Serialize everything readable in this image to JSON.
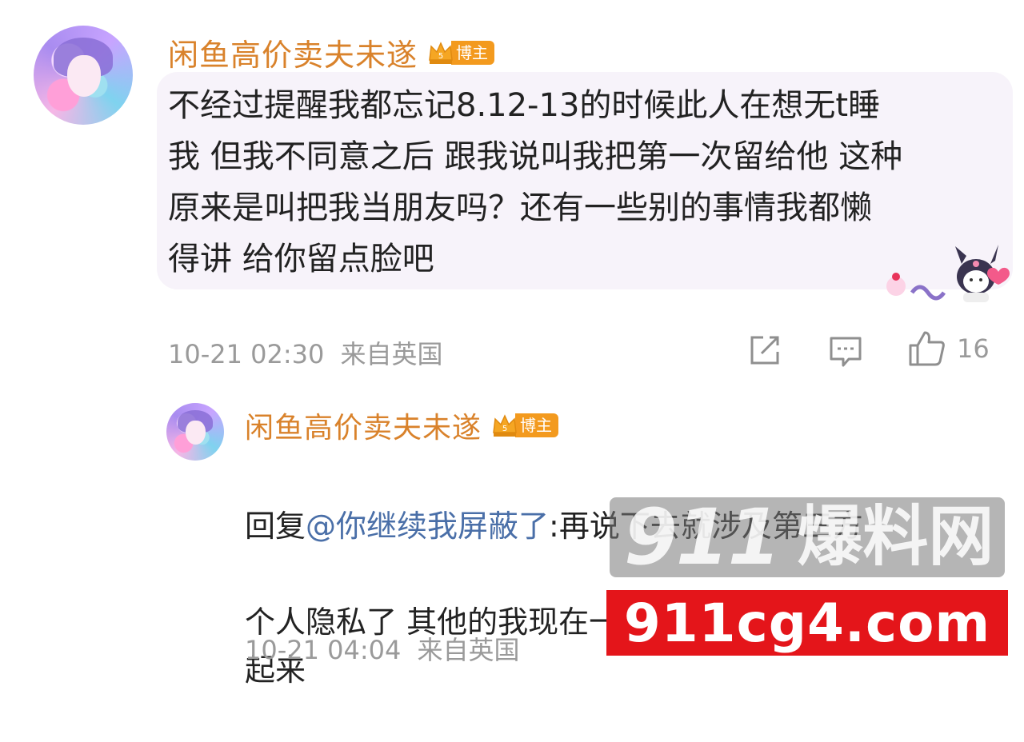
{
  "comment": {
    "username": "闲鱼高价卖夫未遂",
    "badge_label": "博主",
    "badge_level": "5",
    "text": "不经过提醒我都忘记8.12-13的时候此人在想无t睡\n我 但我不同意之后 跟我说叫我把第一次留给他 这种\n原来是叫把我当朋友吗？还有一些别的事情我都懒\n得讲 给你留点脸吧",
    "timestamp": "10-21 02:30",
    "location": "来自英国",
    "like_count": "16"
  },
  "reply": {
    "username": "闲鱼高价卖夫未遂",
    "badge_label": "博主",
    "badge_level": "5",
    "prefix": "回复",
    "mention": "@你继续我屏蔽了",
    "text_line1": ":再说下去就涉及第三方",
    "text_rest": "个人隐私了 其他的我现在一时半会儿想不\n起来",
    "timestamp": "10-21 04:04",
    "location": "来自英国"
  },
  "watermark": {
    "number": "911",
    "text": "爆料网",
    "url": "911cg4.com"
  },
  "icons": [
    "avatar",
    "vip-crown-icon",
    "share-icon",
    "comment-icon",
    "like-icon",
    "kuromi-sticker"
  ],
  "colors": {
    "username": "#d9822b",
    "badge": "#f39a1e",
    "mention": "#4a6fa8",
    "meta": "#9a9a9a",
    "bubble": "#f7f3fa",
    "watermark_red": "#e4151a"
  }
}
